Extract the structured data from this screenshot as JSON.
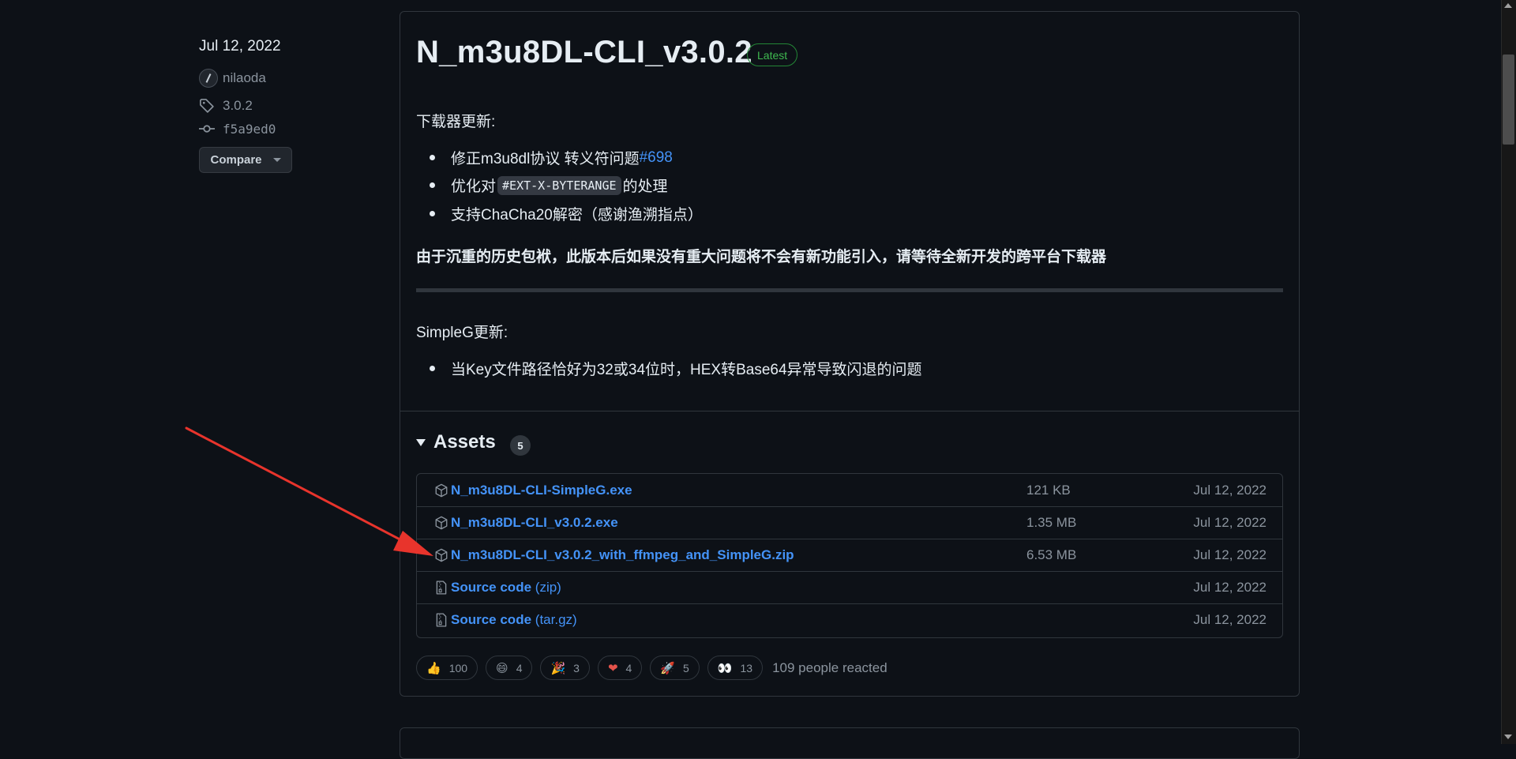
{
  "release": {
    "date": "Jul 12, 2022",
    "author": "nilaoda",
    "tag": "3.0.2",
    "commit": "f5a9ed0",
    "compare_label": "Compare",
    "title": "N_m3u8DL-CLI_v3.0.2",
    "latest_label": "Latest"
  },
  "notes": {
    "heading1": "下载器更新:",
    "b1_text": "修正m3u8dl协议 转义符问题 ",
    "b1_link": "#698",
    "b2_pre": "优化对",
    "b2_code": "#EXT-X-BYTERANGE",
    "b2_post": "的处理",
    "b3_text": "支持ChaCha20解密（感谢渔溯指点）",
    "bold_note": "由于沉重的历史包袱，此版本后如果没有重大问题将不会有新功能引入，请等待全新开发的跨平台下载器",
    "heading2": "SimpleG更新:",
    "b4_text": "当Key文件路径恰好为32或34位时，HEX转Base64异常导致闪退的问题"
  },
  "assets": {
    "title": "Assets",
    "count": "5",
    "items": [
      {
        "name": "N_m3u8DL-CLI-SimpleG.exe",
        "size": "121 KB",
        "date": "Jul 12, 2022",
        "icon": "package-icon"
      },
      {
        "name": "N_m3u8DL-CLI_v3.0.2.exe",
        "size": "1.35 MB",
        "date": "Jul 12, 2022",
        "icon": "package-icon"
      },
      {
        "name": "N_m3u8DL-CLI_v3.0.2_with_ffmpeg_and_SimpleG.zip",
        "size": "6.53 MB",
        "date": "Jul 12, 2022",
        "icon": "package-icon"
      },
      {
        "name": "Source code",
        "suffix": "(zip)",
        "size": "",
        "date": "Jul 12, 2022",
        "icon": "file-zip-icon"
      },
      {
        "name": "Source code",
        "suffix": "(tar.gz)",
        "size": "",
        "date": "Jul 12, 2022",
        "icon": "file-zip-icon"
      }
    ]
  },
  "reactions": {
    "items": [
      {
        "emoji": "👍",
        "count": "100",
        "name": "thumbs-up"
      },
      {
        "emoji": "😄",
        "count": "4",
        "name": "laugh"
      },
      {
        "emoji": "🎉",
        "count": "3",
        "name": "hooray"
      },
      {
        "emoji": "❤",
        "count": "4",
        "name": "heart"
      },
      {
        "emoji": "🚀",
        "count": "5",
        "name": "rocket"
      },
      {
        "emoji": "👀",
        "count": "13",
        "name": "eyes"
      }
    ],
    "summary": "109 people reacted"
  },
  "colors": {
    "background": "#0d1117",
    "link": "#4493f8",
    "latest_green": "#3fb950",
    "annotation_arrow": "#e8342c"
  }
}
